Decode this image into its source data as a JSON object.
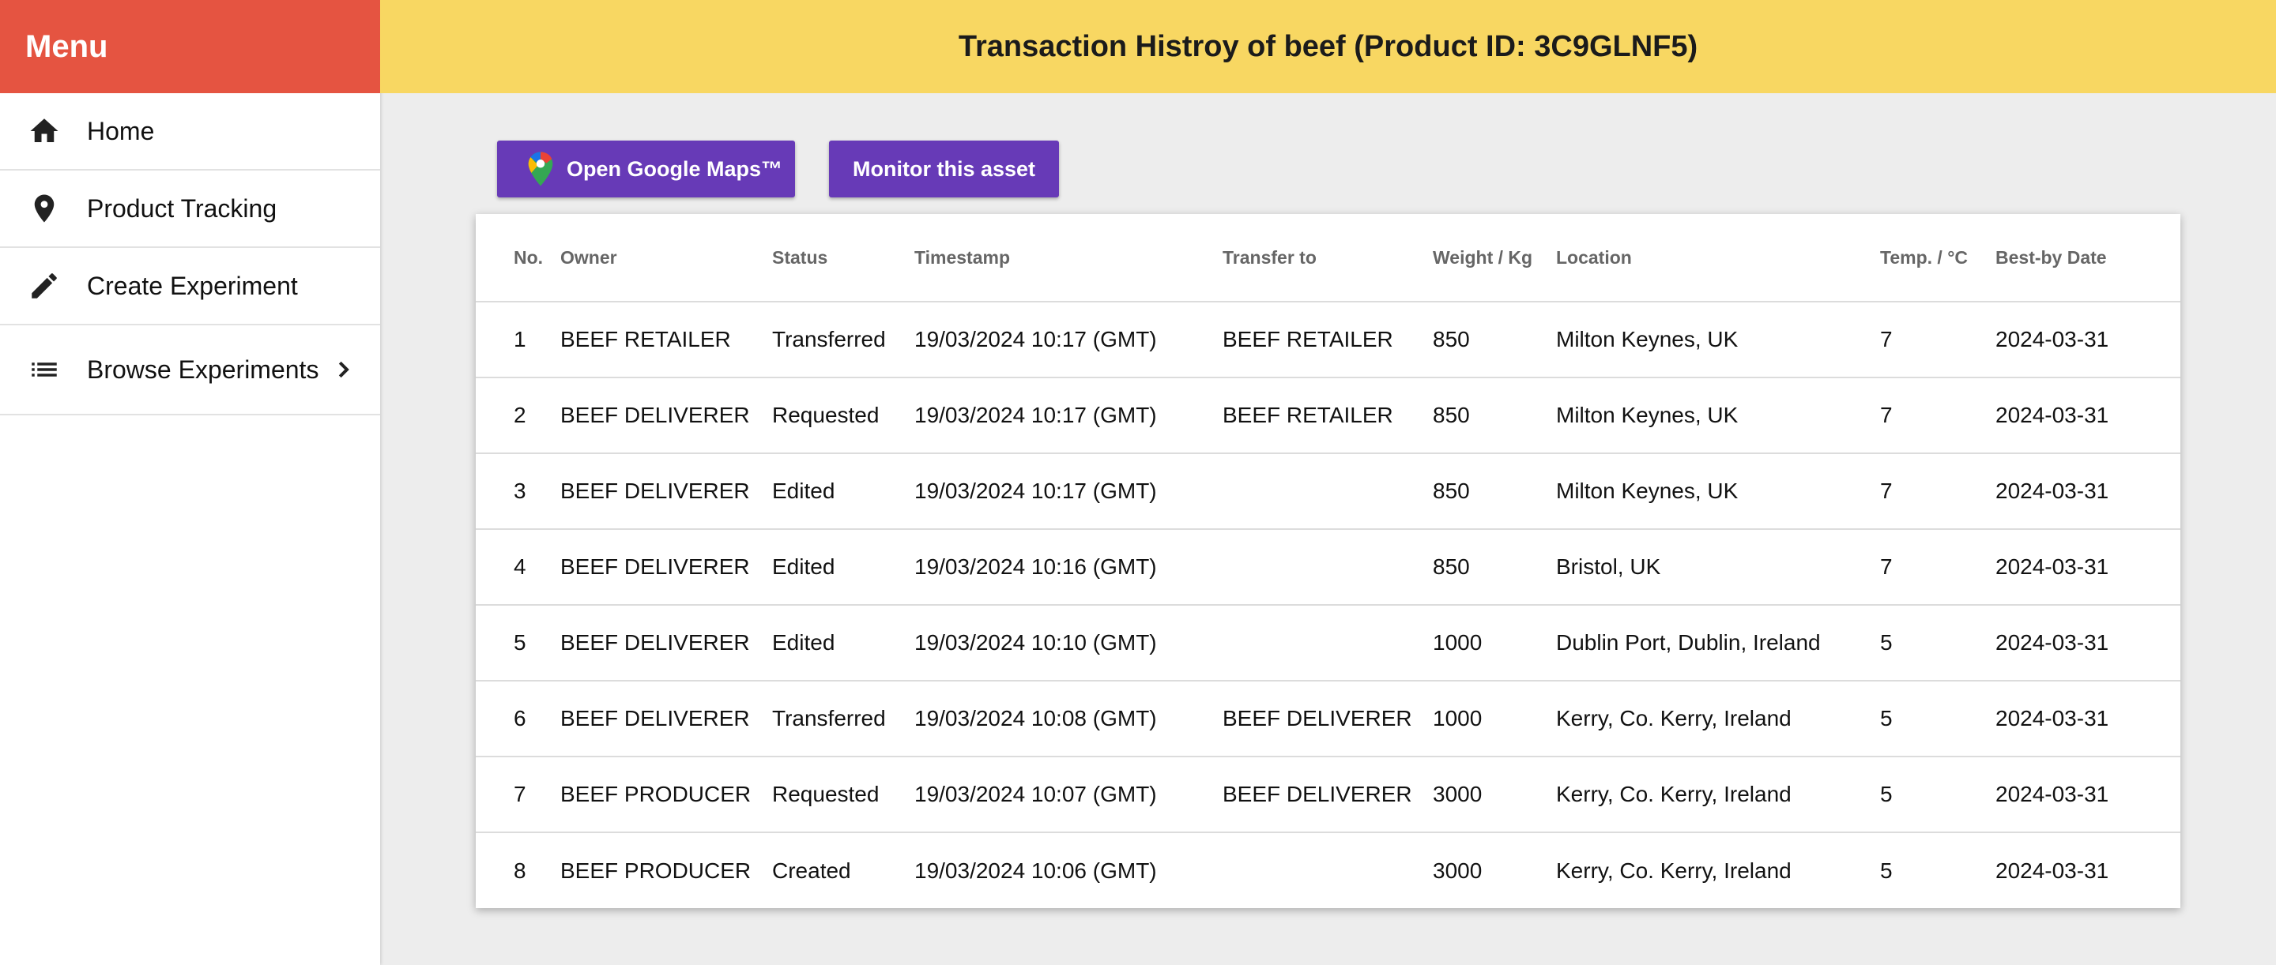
{
  "sidebar": {
    "title": "Menu",
    "items": [
      {
        "label": "Home",
        "icon": "home-icon"
      },
      {
        "label": "Product Tracking",
        "icon": "location-pin-icon"
      },
      {
        "label": "Create Experiment",
        "icon": "pencil-icon"
      },
      {
        "label": "Browse Experiments",
        "icon": "list-icon"
      }
    ]
  },
  "header": {
    "title": "Transaction Histroy of beef (Product ID: 3C9GLNF5)"
  },
  "actions": {
    "maps_label": "Open Google Maps™",
    "monitor_label": "Monitor this asset"
  },
  "table": {
    "columns": [
      "No.",
      "Owner",
      "Status",
      "Timestamp",
      "Transfer to",
      "Weight / Kg",
      "Location",
      "Temp. / °C",
      "Best-by Date"
    ],
    "rows": [
      [
        "1",
        "BEEF RETAILER",
        "Transferred",
        "19/03/2024 10:17 (GMT)",
        "BEEF RETAILER",
        "850",
        "Milton Keynes, UK",
        "7",
        "2024-03-31"
      ],
      [
        "2",
        "BEEF DELIVERER",
        "Requested",
        "19/03/2024 10:17 (GMT)",
        "BEEF RETAILER",
        "850",
        "Milton Keynes, UK",
        "7",
        "2024-03-31"
      ],
      [
        "3",
        "BEEF DELIVERER",
        "Edited",
        "19/03/2024 10:17 (GMT)",
        "",
        "850",
        "Milton Keynes, UK",
        "7",
        "2024-03-31"
      ],
      [
        "4",
        "BEEF DELIVERER",
        "Edited",
        "19/03/2024 10:16 (GMT)",
        "",
        "850",
        "Bristol, UK",
        "7",
        "2024-03-31"
      ],
      [
        "5",
        "BEEF DELIVERER",
        "Edited",
        "19/03/2024 10:10 (GMT)",
        "",
        "1000",
        "Dublin Port, Dublin, Ireland",
        "5",
        "2024-03-31"
      ],
      [
        "6",
        "BEEF DELIVERER",
        "Transferred",
        "19/03/2024 10:08 (GMT)",
        "BEEF DELIVERER",
        "1000",
        "Kerry, Co. Kerry, Ireland",
        "5",
        "2024-03-31"
      ],
      [
        "7",
        "BEEF PRODUCER",
        "Requested",
        "19/03/2024 10:07 (GMT)",
        "BEEF DELIVERER",
        "3000",
        "Kerry, Co. Kerry, Ireland",
        "5",
        "2024-03-31"
      ],
      [
        "8",
        "BEEF PRODUCER",
        "Created",
        "19/03/2024 10:06 (GMT)",
        "",
        "3000",
        "Kerry, Co. Kerry, Ireland",
        "5",
        "2024-03-31"
      ]
    ]
  },
  "colors": {
    "menu_header": "#e55441",
    "topbar": "#f8d762",
    "button": "#673ab7",
    "background": "#ededed"
  }
}
